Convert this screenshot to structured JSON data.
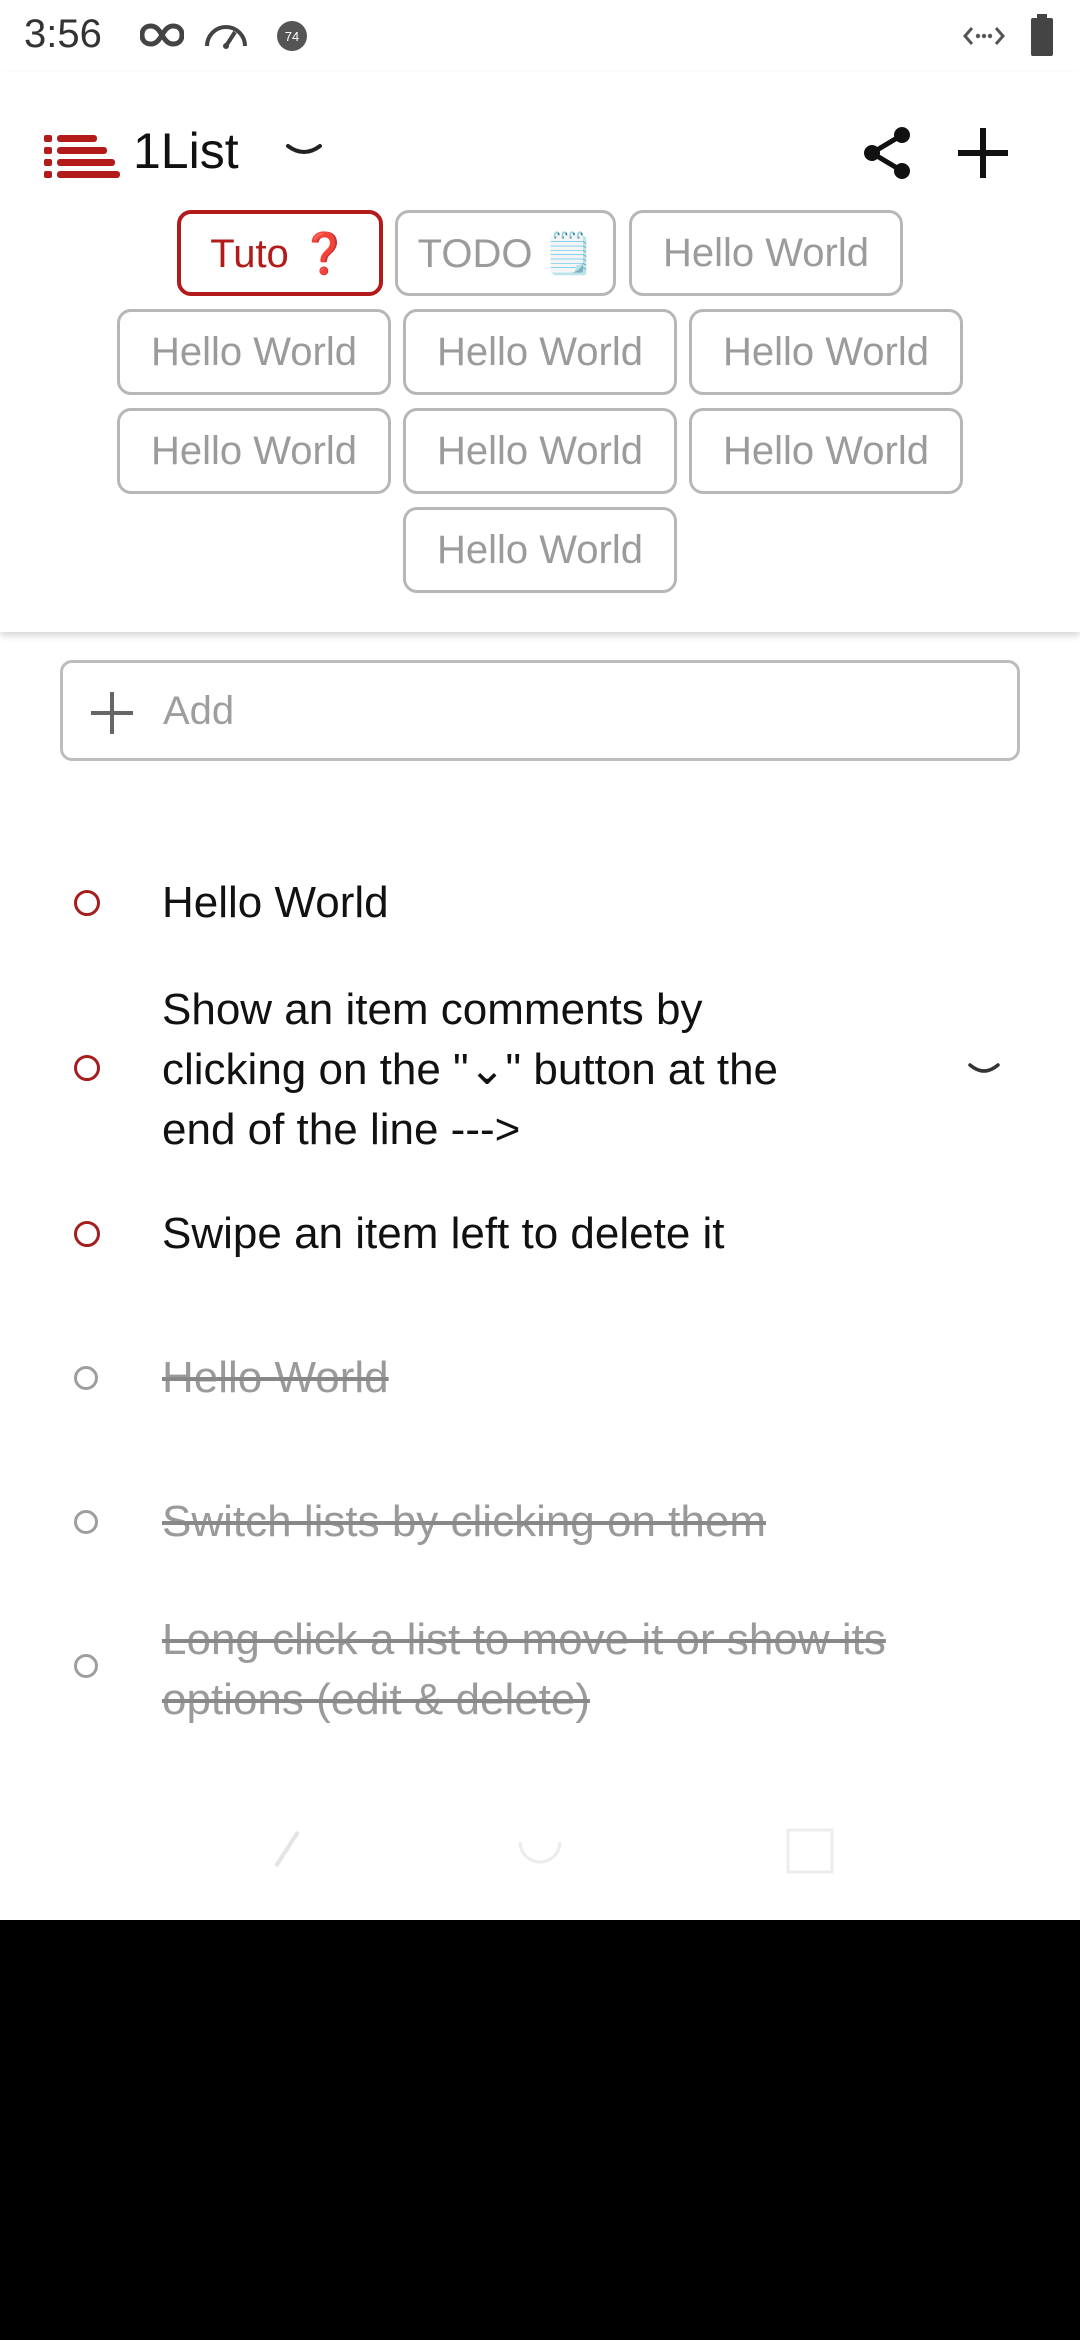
{
  "status_bar": {
    "time": "3:56",
    "icons_left": [
      "infinity-icon",
      "speedometer-icon",
      "notification-badge-icon"
    ],
    "badge_number": "74",
    "icons_right": [
      "data-sync-icon",
      "battery-icon"
    ]
  },
  "header": {
    "app_name": "1List",
    "logo_icon": "list-logo-icon",
    "share_icon": "share-icon",
    "add_icon": "plus-icon",
    "accent_color": "#b31b1b"
  },
  "lists": [
    {
      "label": "Tuto ❓",
      "active": true
    },
    {
      "label": "TODO 🗒️",
      "active": false
    },
    {
      "label": "Hello World",
      "active": false
    },
    {
      "label": "Hello World",
      "active": false
    },
    {
      "label": "Hello World",
      "active": false
    },
    {
      "label": "Hello World",
      "active": false
    },
    {
      "label": "Hello World",
      "active": false
    },
    {
      "label": "Hello World",
      "active": false
    },
    {
      "label": "Hello World",
      "active": false
    },
    {
      "label": "Hello World",
      "active": false
    }
  ],
  "add_field": {
    "placeholder": "Add",
    "value": ""
  },
  "items": [
    {
      "lines": [
        "Hello World"
      ],
      "done": false,
      "has_comments": false
    },
    {
      "lines": [
        "Show an item comments by",
        "clicking on the \"⌄\" button at the",
        "end of the line --->"
      ],
      "done": false,
      "has_comments": true
    },
    {
      "lines": [
        "Swipe an item left to delete it"
      ],
      "done": false,
      "has_comments": false
    },
    {
      "lines": [
        "Hello World"
      ],
      "done": true,
      "has_comments": false
    },
    {
      "lines": [
        "Switch lists by clicking on them"
      ],
      "done": true,
      "has_comments": false
    },
    {
      "lines": [
        "Long click a list to move it or show its",
        "options (edit & delete)"
      ],
      "done": true,
      "has_comments": false
    }
  ]
}
